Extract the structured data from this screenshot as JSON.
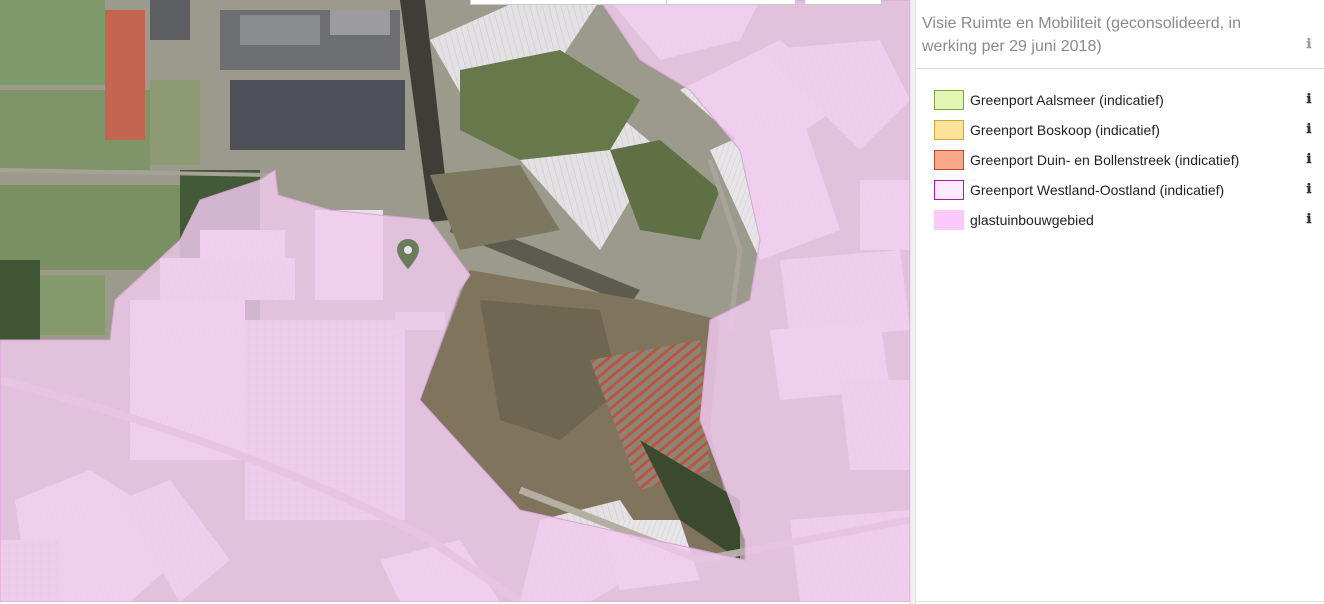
{
  "panel": {
    "title": "Visie Ruimte en Mobiliteit (geconsolideerd, in werking per 29 juni 2018)",
    "info_icon": "info-icon"
  },
  "legend": {
    "items": [
      {
        "label": "Greenport Aalsmeer (indicatief)",
        "fill": "#e3f7b4",
        "border": "#7aa63c",
        "icon": "info-icon"
      },
      {
        "label": "Greenport Boskoop (indicatief)",
        "fill": "#fbe39a",
        "border": "#d4a53a",
        "icon": "info-icon"
      },
      {
        "label": "Greenport Duin- en Bollenstreek (indicatief)",
        "fill": "#f7a98a",
        "border": "#c8472c",
        "icon": "info-icon"
      },
      {
        "label": "Greenport Westland-Oostland (indicatief)",
        "fill": "#fdeaff",
        "border": "#a21ca6",
        "icon": "info-icon"
      },
      {
        "label": "glastuinbouwgebied",
        "fill": "#fbc8fb",
        "border": "#fbc8fb",
        "icon": "info-icon"
      }
    ]
  },
  "map": {
    "marker_icon": "map-pin-icon",
    "overlay_color": "#f2c9ef",
    "basemap": "aerial-photo"
  }
}
